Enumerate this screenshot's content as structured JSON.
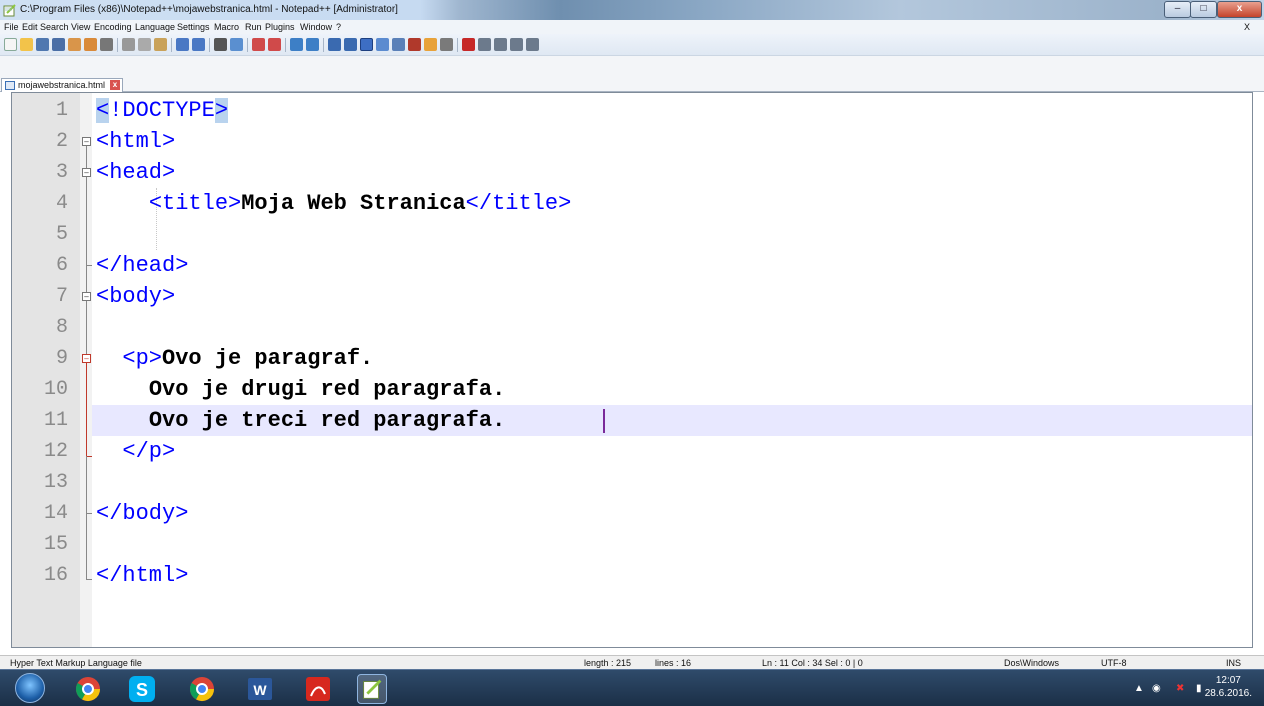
{
  "window": {
    "title": "C:\\Program Files (x86)\\Notepad++\\mojawebstranica.html - Notepad++ [Administrator]"
  },
  "menu": {
    "items": [
      "File",
      "Edit",
      "Search",
      "View",
      "Encoding",
      "Language",
      "Settings",
      "Macro",
      "Run",
      "Plugins",
      "Window",
      "?"
    ],
    "close_doc": "X"
  },
  "tab": {
    "label": "mojawebstranica.html",
    "close": "x"
  },
  "editor": {
    "line_numbers": [
      "1",
      "2",
      "3",
      "4",
      "5",
      "6",
      "7",
      "8",
      "9",
      "10",
      "11",
      "12",
      "13",
      "14",
      "15",
      "16"
    ],
    "lines": {
      "l1_open": "<",
      "l1_mid": "!DOCTYPE",
      "l1_close": ">",
      "l2": "<html>",
      "l3": "<head>",
      "l4_indent": "    ",
      "l4_open": "<title>",
      "l4_text": "Moja Web Stranica",
      "l4_close": "</title>",
      "l6": "</head>",
      "l7": "<body>",
      "l9_indent": "  ",
      "l9_tag": "<p>",
      "l9_text": "Ovo je paragraf.",
      "l10_indent": "    ",
      "l10_text": "Ovo je drugi red paragrafa.",
      "l11_indent": "    ",
      "l11_text": "Ovo je treci red paragrafa.",
      "l12_indent": "  ",
      "l12_tag": "</p>",
      "l14": "</body>",
      "l16": "</html>"
    },
    "current_line": 11
  },
  "status": {
    "language": "Hyper Text Markup Language file",
    "length": "length : 215",
    "lines": "lines : 16",
    "position": "Ln : 11   Col : 34   Sel : 0 | 0",
    "eol": "Dos\\Windows",
    "encoding": "UTF-8",
    "mode": "INS"
  },
  "taskbar": {
    "time": "12:07",
    "date": "28.6.2016."
  }
}
